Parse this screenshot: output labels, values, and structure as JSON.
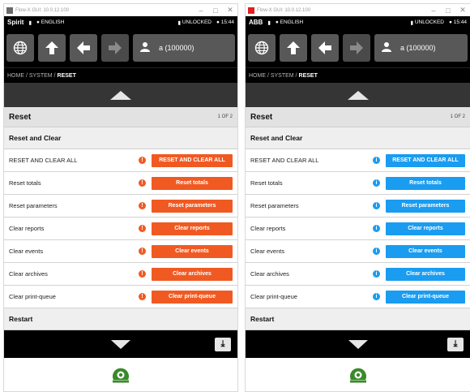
{
  "windows": [
    {
      "title": "Flow-X GUI: 10.0.12.100",
      "brand": "Spirit",
      "language": "ENGLISH",
      "lock_status": "UNLOCKED",
      "time": "15:44",
      "user": "a (100000)",
      "breadcrumb_path": "HOME / SYSTEM /",
      "breadcrumb_current": "RESET",
      "panel_title": "Reset",
      "page_indicator": "1 OF 2",
      "section_reset": "Reset and Clear",
      "section_restart": "Restart",
      "accent_color": "#f05a22",
      "rows": [
        {
          "label": "RESET AND CLEAR ALL",
          "button": "RESET AND CLEAR ALL"
        },
        {
          "label": "Reset totals",
          "button": "Reset totals"
        },
        {
          "label": "Reset parameters",
          "button": "Reset parameters"
        },
        {
          "label": "Clear reports",
          "button": "Clear reports"
        },
        {
          "label": "Clear events",
          "button": "Clear events"
        },
        {
          "label": "Clear archives",
          "button": "Clear archives"
        },
        {
          "label": "Clear print-queue",
          "button": "Clear print-queue"
        }
      ]
    },
    {
      "title": "Flow-X GUI: 10.0.12.100",
      "brand": "ABB",
      "language": "ENGLISH",
      "lock_status": "UNLOCKED",
      "time": "15:44",
      "user": "a (100000)",
      "breadcrumb_path": "HOME / SYSTEM /",
      "breadcrumb_current": "RESET",
      "panel_title": "Reset",
      "page_indicator": "1 OF 2",
      "section_reset": "Reset and Clear",
      "section_restart": "Restart",
      "accent_color": "#1a9cf0",
      "rows": [
        {
          "label": "RESET AND CLEAR ALL",
          "button": "RESET AND CLEAR ALL"
        },
        {
          "label": "Reset totals",
          "button": "Reset totals"
        },
        {
          "label": "Reset parameters",
          "button": "Reset parameters"
        },
        {
          "label": "Clear reports",
          "button": "Clear reports"
        },
        {
          "label": "Clear events",
          "button": "Clear events"
        },
        {
          "label": "Clear archives",
          "button": "Clear archives"
        },
        {
          "label": "Clear print-queue",
          "button": "Clear print-queue"
        }
      ]
    }
  ],
  "icons": {
    "globe": "globe-icon",
    "home": "up-arrow-icon",
    "back": "left-arrow-icon",
    "forward": "right-arrow-icon",
    "user": "user-icon",
    "info": "info-icon",
    "logo": "flowx-logo-icon",
    "logo_color": "#3a8a2a"
  }
}
